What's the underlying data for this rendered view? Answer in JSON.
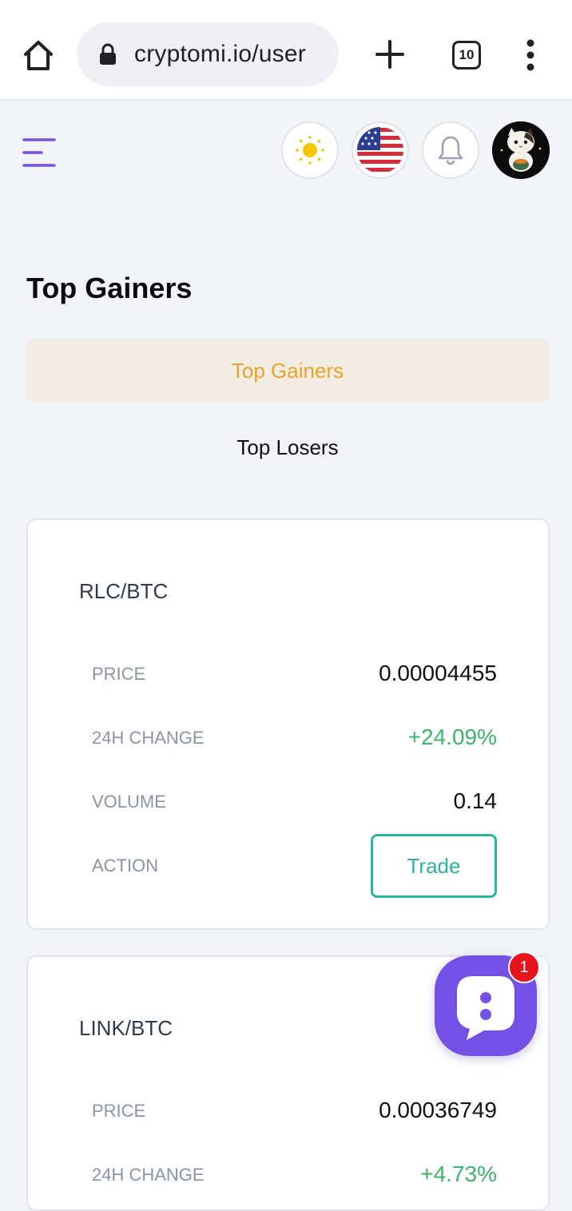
{
  "browser": {
    "url": "cryptomi.io/user",
    "tab_count": "10"
  },
  "header": {
    "icons": [
      "menu-icon",
      "sun-icon",
      "us-flag-icon",
      "bell-icon",
      "avatar"
    ]
  },
  "page": {
    "title": "Top Gainers",
    "tabs": [
      {
        "label": "Top Gainers",
        "active": true
      },
      {
        "label": "Top Losers",
        "active": false
      }
    ]
  },
  "labels": {
    "price": "PRICE",
    "change": "24H CHANGE",
    "volume": "VOLUME",
    "action": "ACTION",
    "trade": "Trade"
  },
  "cards": [
    {
      "pair": "RLC/BTC",
      "price": "0.00004455",
      "change": "+24.09%",
      "volume": "0.14"
    },
    {
      "pair": "LINK/BTC",
      "price": "0.00036749",
      "change": "+4.73%"
    }
  ],
  "chat": {
    "badge": "1"
  },
  "colors": {
    "accent_purple": "#7550e6",
    "tab_active_text": "#eba32a",
    "positive": "#3bb56a",
    "trade_teal": "#2bb3a0"
  }
}
